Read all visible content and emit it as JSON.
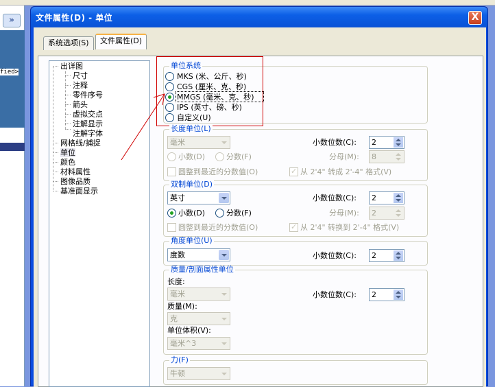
{
  "left_pane": {
    "expander": "»",
    "fragment": "fied>"
  },
  "window": {
    "title": "文件属性(D) - 单位",
    "close_symbol": "X"
  },
  "tabs": [
    {
      "label": "系统选项(S)",
      "active": false
    },
    {
      "label": "文件属性(D)",
      "active": true
    }
  ],
  "tree": {
    "items": [
      {
        "label": "出详图",
        "level": 0
      },
      {
        "label": "尺寸",
        "level": 1
      },
      {
        "label": "注释",
        "level": 1
      },
      {
        "label": "零件序号",
        "level": 1
      },
      {
        "label": "箭头",
        "level": 1
      },
      {
        "label": "虚拟交点",
        "level": 1
      },
      {
        "label": "注解显示",
        "level": 1
      },
      {
        "label": "注解字体",
        "level": 1
      },
      {
        "label": "网格线/捕捉",
        "level": 0
      },
      {
        "label": "单位",
        "level": 0,
        "selected": true
      },
      {
        "label": "颜色",
        "level": 0
      },
      {
        "label": "材料属性",
        "level": 0
      },
      {
        "label": "图像品质",
        "level": 0
      },
      {
        "label": "基准面显示",
        "level": 0
      }
    ]
  },
  "unit_system": {
    "title": "单位系统",
    "options": [
      {
        "label": "MKS (米、公斤、秒)",
        "selected": false
      },
      {
        "label": "CGS (厘米、克、秒)",
        "selected": false
      },
      {
        "label": "MMGS (毫米、克、秒)",
        "selected": true
      },
      {
        "label": "IPS (英寸、磅、秒)",
        "selected": false
      },
      {
        "label": "自定义(U)",
        "selected": false
      }
    ]
  },
  "length_unit": {
    "title": "长度单位(L)",
    "combo_value": "毫米",
    "decimal_label": "小数(D)",
    "fraction_label": "分数(F)",
    "decimal_places_label": "小数位数(C):",
    "decimal_places_value": "2",
    "denominator_label": "分母(M):",
    "denominator_value": "8",
    "round_label": "圆整到最近的分数值(O)",
    "convert_label": "从 2'4\" 转成 2'-4\" 格式(V)"
  },
  "dual_unit": {
    "title": "双制单位(D)",
    "combo_value": "英寸",
    "decimal_label": "小数(D)",
    "fraction_label": "分数(F)",
    "decimal_places_label": "小数位数(C):",
    "decimal_places_value": "2",
    "denominator_label": "分母(M):",
    "denominator_value": "2",
    "round_label": "圆整到最近的分数值(O)",
    "convert_label": "从 2'4\" 转换到 2'-4\" 格式(V)"
  },
  "angle_unit": {
    "title": "角度单位(U)",
    "combo_value": "度数",
    "decimal_places_label": "小数位数(C):",
    "decimal_places_value": "2"
  },
  "mass_section": {
    "title": "质量/剖面属性单位",
    "length_label": "长度:",
    "length_value": "毫米",
    "decimal_places_label": "小数位数(C):",
    "decimal_places_value": "2",
    "mass_label": "质量(M):",
    "mass_value": "克",
    "volume_label": "单位体积(V):",
    "volume_value": "毫米^3"
  },
  "force": {
    "title": "力(F)",
    "combo_value": "牛顿"
  },
  "colors": {
    "title_blue": "#0046d5",
    "highlight_red": "#d00000"
  }
}
